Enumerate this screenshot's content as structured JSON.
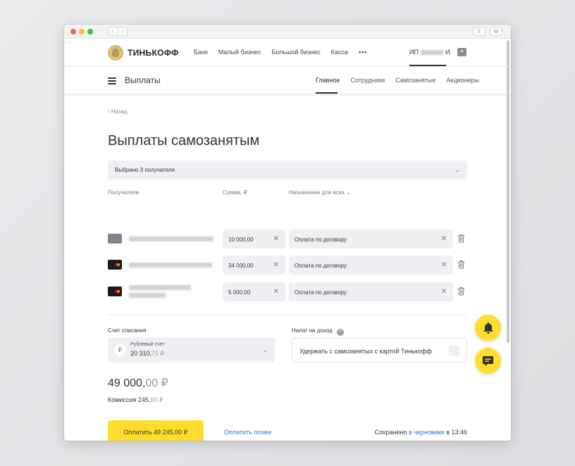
{
  "browser": {
    "nav_back": "‹",
    "nav_forward": "›",
    "share_icon": "⇪",
    "tabs_icon": "⧉"
  },
  "header": {
    "brand": "ТИНЬКОФФ",
    "menu": [
      "Банк",
      "Малый бизнес",
      "Большой бизнес",
      "Касса"
    ],
    "more": "•••",
    "account_prefix": "ИП",
    "account_suffix": "И.",
    "account_dropdown": "▾"
  },
  "subnav": {
    "title": "Выплаты",
    "tabs": [
      "Главное",
      "Сотрудники",
      "Самозанятые",
      "Акционеры"
    ]
  },
  "page": {
    "back": "Назад",
    "title": "Выплаты самозанятым",
    "selector_label": "Выбрано 3 получателя",
    "columns": {
      "recipients": "Получатели",
      "amount": "Сумма, ₽",
      "purpose": "Назначение для всех"
    },
    "rows": [
      {
        "amount": "10 000,00",
        "purpose": "Оплата по договору",
        "card": "gray"
      },
      {
        "amount": "34 000,00",
        "purpose": "Оплата по договору",
        "card": "black"
      },
      {
        "amount": "5 000,00",
        "purpose": "Оплата по договору",
        "card": "black"
      }
    ],
    "debit_label": "Счет списания",
    "account_name": "Рублевый счет",
    "account_amount_main": "20 310,",
    "account_amount_dim": "75 ₽",
    "tax_label": "Налог на доход",
    "tax_help": "?",
    "tax_option": "Удержать с самозанятых с картой Тинькофф",
    "total_main": "49 000,",
    "total_dim": "00 ₽",
    "commission_main": "Комиссия 245,",
    "commission_dim": "00 ₽",
    "pay_button": "Оплатить 49 245,00 ₽",
    "pay_later": "Оплатить позже",
    "saved_prefix": "Сохранено ",
    "saved_link": "в черновики",
    "saved_suffix": " в 13:46"
  },
  "icons": {
    "clear": "✕",
    "chevron": "⌄",
    "back_chevron": "‹",
    "ruble": "₽"
  },
  "colors": {
    "accent_yellow": "#ffdd2d",
    "link_blue": "#336fee",
    "field_bg": "#eef0f3"
  }
}
